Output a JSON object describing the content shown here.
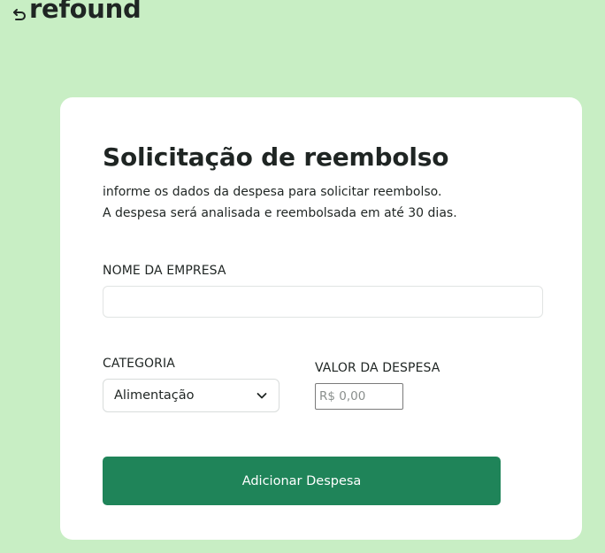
{
  "brand": {
    "name": "refound",
    "icon": "return-arrow-icon"
  },
  "form": {
    "title": "Solicitação de reembolso",
    "subtitle_line1": "informe os dados da despesa para solicitar reembolso.",
    "subtitle_line2": "A despesa será analisada e reembolsada em até 30 dias.",
    "company": {
      "label": "NOME DA EMPRESA",
      "value": "",
      "placeholder": ""
    },
    "category": {
      "label": "CATEGORIA",
      "selected": "Alimentação",
      "icon": "chevron-down-icon"
    },
    "amount": {
      "label": "VALOR DA DESPESA",
      "value": "",
      "placeholder": "R$ 0,00"
    },
    "submit_label": "Adicionar Despesa"
  },
  "colors": {
    "background": "#c8eec4",
    "card": "#ffffff",
    "primary_button": "#1f8459",
    "text": "#1f2523"
  }
}
